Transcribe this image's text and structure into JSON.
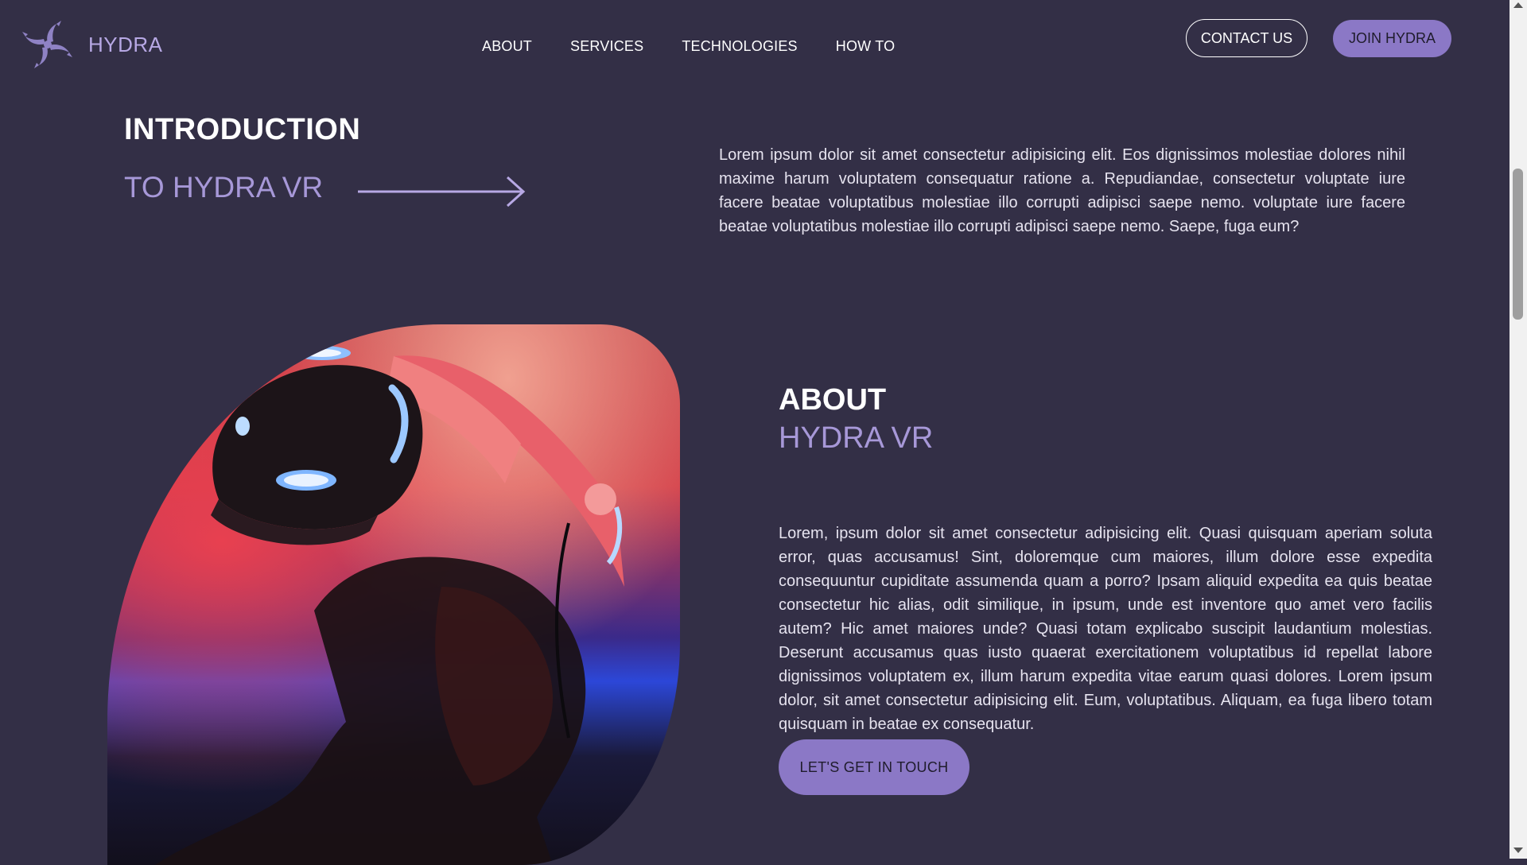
{
  "header": {
    "brand": "HYDRA",
    "nav": [
      "ABOUT",
      "SERVICES",
      "TECHNOLOGIES",
      "HOW TO"
    ],
    "contact_label": "CONTACT US",
    "join_label": "JOIN HYDRA"
  },
  "intro": {
    "title": "INTRODUCTION",
    "subtitle": "TO HYDRA VR",
    "text": "Lorem ipsum dolor sit amet consectetur adipisicing elit. Eos dignissimos molestiae dolores nihil maxime harum voluptatem consequatur ratione a. Repudiandae, consectetur voluptate iure facere beatae voluptatibus molestiae illo corrupti adipisci saepe nemo. voluptate iure facere beatae voluptatibus molestiae illo corrupti adipisci saepe nemo. Saepe, fuga eum?"
  },
  "about": {
    "title": "ABOUT",
    "subtitle": "HYDRA VR",
    "text": "Lorem, ipsum dolor sit amet consectetur adipisicing elit. Quasi quisquam aperiam soluta error, quas accusamus! Sint, doloremque cum maiores, illum dolore esse expedita consequuntur cupiditate assumenda quam a porro? Ipsam aliquid expedita ea quis beatae consectetur hic alias, odit similique, in ipsum, unde est inventore quo amet vero facilis autem? Hic amet maiores unde? Quasi totam explicabo suscipit laudantium molestias. Deserunt accusamus quas iusto quaerat exercitationem voluptatibus id repellat labore dignissimos voluptatem ex, illum harum expedita vitae earum quasi dolores. Lorem ipsum dolor, sit amet consectetur adipisicing elit. Eum, voluptatibus. Aliquam, ea fuga libero totam quisquam in beatae ex consequatur.",
    "cta_label": "LET'S GET IN TOUCH"
  },
  "colors": {
    "background": "#332f46",
    "accent": "#8b78c6",
    "accent_text": "#a798d8"
  },
  "icons": {
    "logo": "hydra-swirl-icon",
    "arrow": "arrow-right-icon"
  }
}
